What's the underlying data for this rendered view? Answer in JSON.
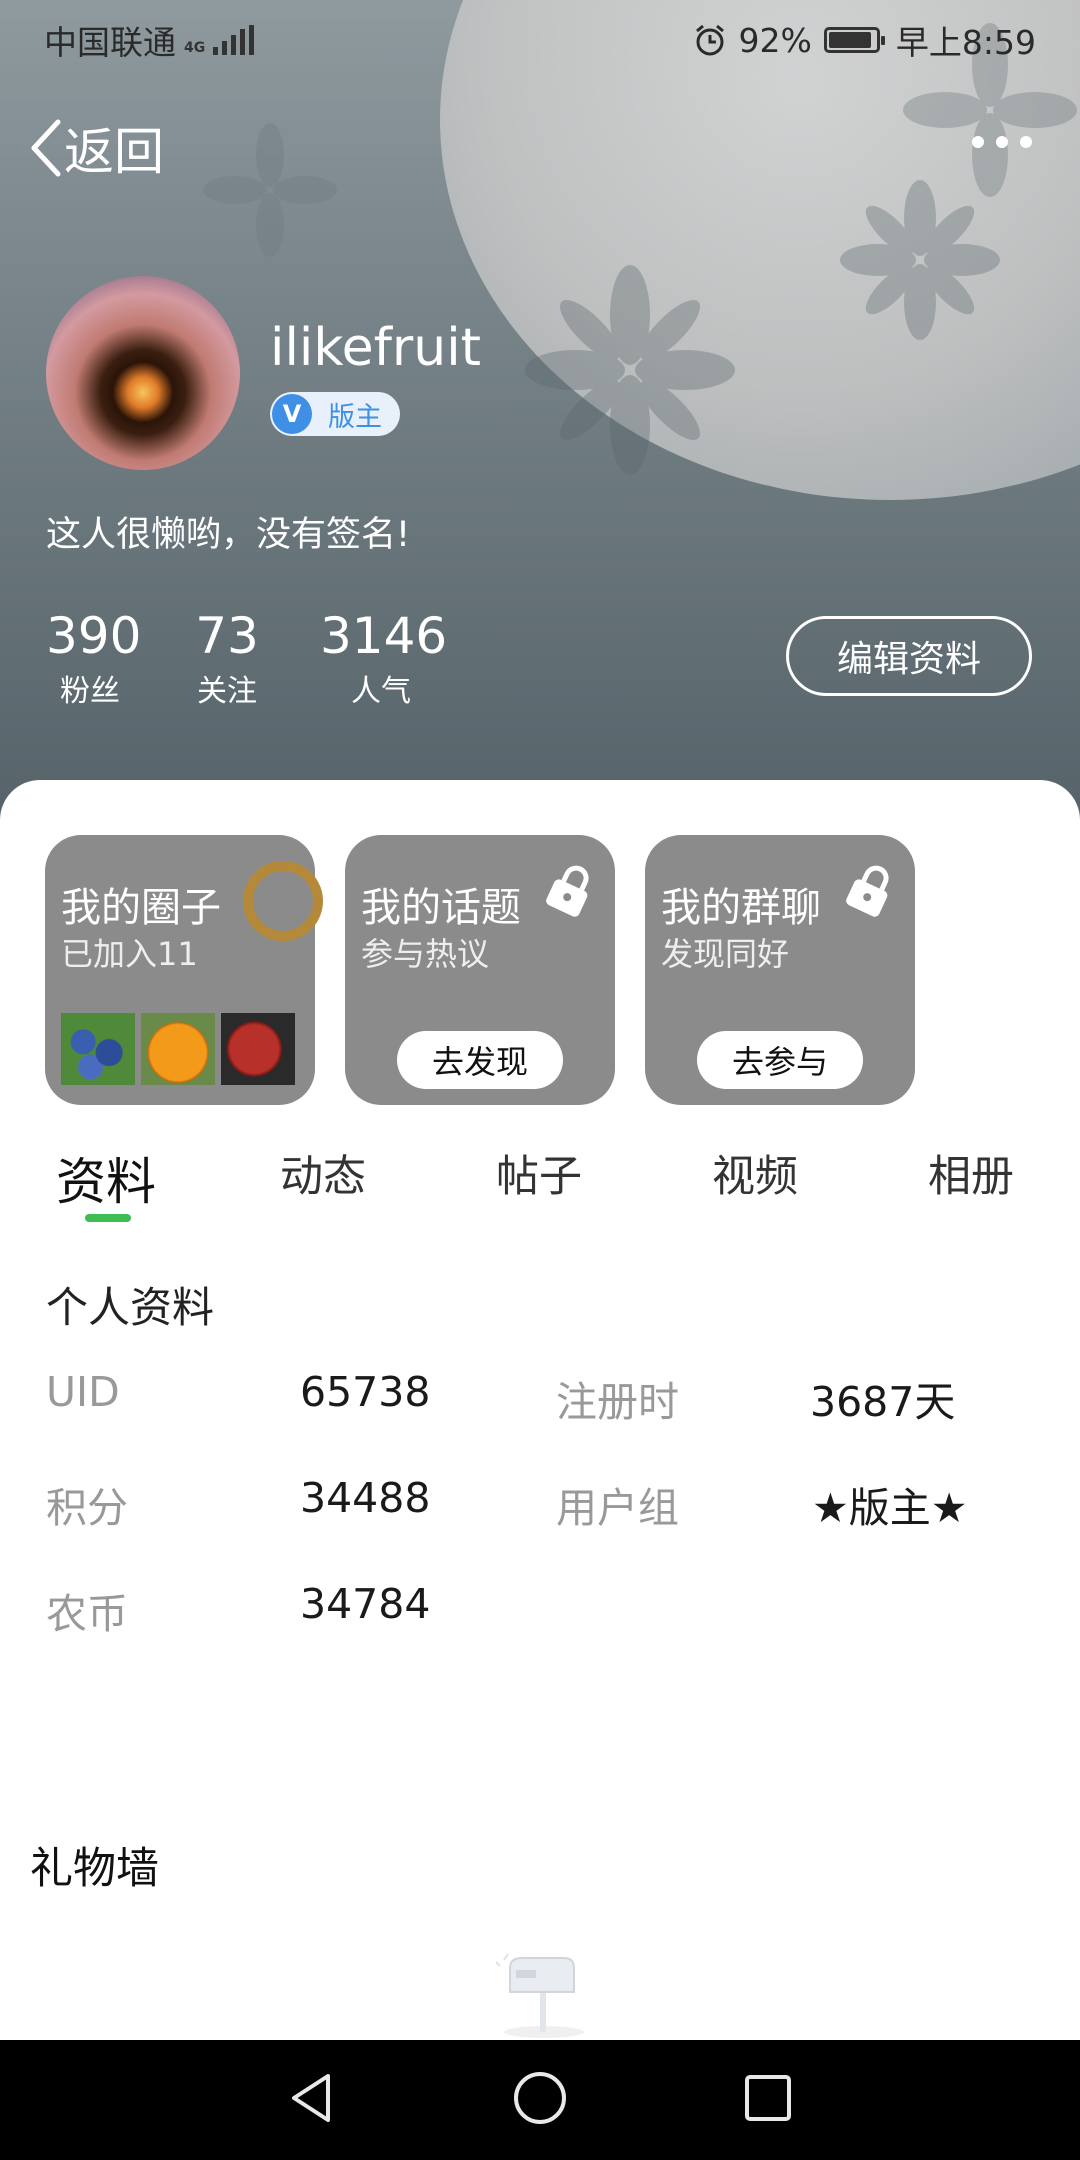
{
  "status_bar": {
    "carrier": "中国联通",
    "network": "4G",
    "battery_percent": "92%",
    "battery_level": 0.92,
    "time": "早上8:59"
  },
  "nav": {
    "back_label": "返回"
  },
  "profile": {
    "username": "ilikefruit",
    "badge_icon": "V",
    "badge_label": "版主",
    "signature": "这人很懒哟，没有签名!",
    "stats": [
      {
        "value": "390",
        "label": "粉丝"
      },
      {
        "value": "73",
        "label": "关注"
      },
      {
        "value": "3146",
        "label": "人气"
      }
    ],
    "edit_label": "编辑资料"
  },
  "cards": [
    {
      "title": "我的圈子",
      "subtitle": "已加入11"
    },
    {
      "title": "我的话题",
      "subtitle": "参与热议",
      "action": "去发现"
    },
    {
      "title": "我的群聊",
      "subtitle": "发现同好",
      "action": "去参与"
    }
  ],
  "tabs": [
    "资料",
    "动态",
    "帖子",
    "视频",
    "相册"
  ],
  "info": {
    "title": "个人资料",
    "fields": [
      {
        "label": "UID",
        "value": "65738"
      },
      {
        "label": "注册时",
        "value": "3687天"
      },
      {
        "label": "积分",
        "value": "34488"
      },
      {
        "label": "用户组",
        "value": "★版主★"
      },
      {
        "label": "农币",
        "value": "34784"
      }
    ]
  },
  "gift_wall": {
    "title": "礼物墙"
  },
  "colors": {
    "accent": "#3dbd52",
    "badge_blue": "#3f8fe6",
    "card_gray": "#8b8b8b"
  }
}
